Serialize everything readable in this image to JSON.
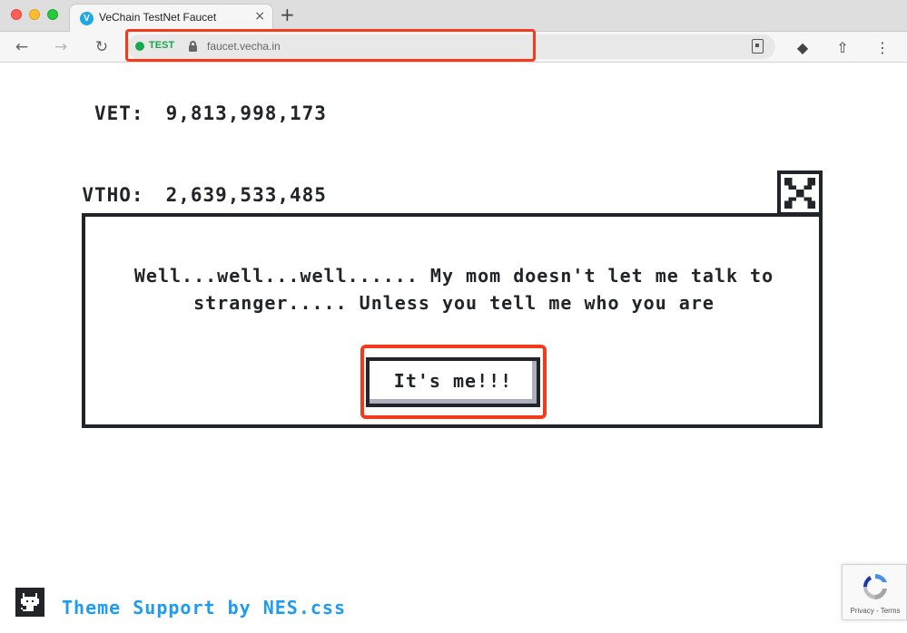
{
  "browser": {
    "tab_title": "VeChain TestNet Faucet",
    "tab_favicon": "V",
    "tab_close": "×",
    "new_tab": "+",
    "security_label": "TEST",
    "url": "faucet.vecha.in",
    "nav": {
      "back": "←",
      "forward": "→",
      "reload": "↻"
    },
    "extensions": [
      "wallet-icon",
      "upload-icon",
      "more-icon"
    ],
    "ext_glyphs": [
      "◆",
      "⇧",
      "⋮"
    ]
  },
  "balances": [
    {
      "label": "VET:",
      "value": "9,813,998,173"
    },
    {
      "label": "VTHO:",
      "value": "2,639,533,485"
    }
  ],
  "dialog": {
    "message": "Well...well...well...... My mom doesn't let me talk to stranger..... Unless you tell me who you are",
    "button_label": "It's me!!!"
  },
  "footer": {
    "link_text": "Theme Support by NES.css"
  },
  "recaptcha": {
    "terms": "Privacy - Terms"
  },
  "colors": {
    "highlight": "#f5391b",
    "link": "#209cee",
    "secure": "#16a84b",
    "text": "#212529"
  }
}
